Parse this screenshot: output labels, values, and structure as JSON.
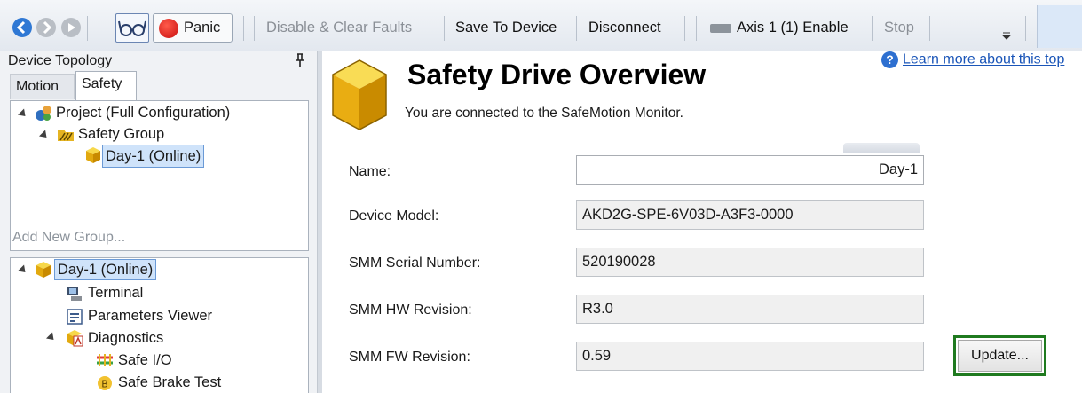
{
  "toolbar": {
    "panic_label": "Panic",
    "disable_clear_faults_label": "Disable & Clear Faults",
    "save_to_device_label": "Save To Device",
    "disconnect_label": "Disconnect",
    "axis_enable_label": "Axis 1 (1) Enable",
    "stop_label": "Stop",
    "icons": [
      "back-icon",
      "forward-icon",
      "refresh-icon",
      "glasses-icon",
      "panic-icon",
      "axis-enable-icon",
      "overflow-dropdown-icon"
    ]
  },
  "left_panel": {
    "title": "Device Topology",
    "pin_glyph": "p",
    "tabs": [
      {
        "label": "Motion",
        "active": false
      },
      {
        "label": "Safety",
        "active": true
      }
    ],
    "safety_tree": [
      {
        "label": "Project (Full Configuration)",
        "icon": "project-icon",
        "level": 0,
        "expanded": true
      },
      {
        "label": "Safety Group",
        "icon": "safety-group-icon",
        "level": 1,
        "expanded": true
      },
      {
        "label": "Day-1 (Online)",
        "icon": "drive-cube-icon",
        "level": 2,
        "selected": true
      }
    ],
    "add_new_group": "Add New Group...",
    "device_tree": [
      {
        "label": "Day-1 (Online)",
        "icon": "drive-cube-icon",
        "level": 0,
        "expanded": true,
        "selected": true
      },
      {
        "label": "Terminal",
        "icon": "terminal-icon",
        "level": 1
      },
      {
        "label": "Parameters Viewer",
        "icon": "parameters-viewer-icon",
        "level": 1
      },
      {
        "label": "Diagnostics",
        "icon": "diagnostics-icon",
        "level": 1,
        "expanded": true
      },
      {
        "label": "Safe I/O",
        "icon": "safe-io-icon",
        "level": 2
      },
      {
        "label": "Safe Brake Test",
        "icon": "safe-brake-test-icon",
        "level": 2
      }
    ]
  },
  "main": {
    "title": "Safety Drive Overview",
    "subtitle": "You are connected to the SafeMotion Monitor.",
    "help_link": "Learn more about this top",
    "fields": [
      {
        "label": "Name:",
        "value": "Day-1",
        "editable": true
      },
      {
        "label": "Device Model:",
        "value": "AKD2G-SPE-6V03D-A3F3-0000",
        "editable": false
      },
      {
        "label": "SMM Serial Number:",
        "value": "520190028",
        "editable": false
      },
      {
        "label": "SMM HW Revision:",
        "value": "R3.0",
        "editable": false
      },
      {
        "label": "SMM FW Revision:",
        "value": "0.59",
        "editable": false
      }
    ],
    "update_button": "Update...",
    "colors": {
      "highlight_border": "#1f7a1f",
      "selection": "#cfe3fa",
      "link": "#1a55b8"
    }
  }
}
